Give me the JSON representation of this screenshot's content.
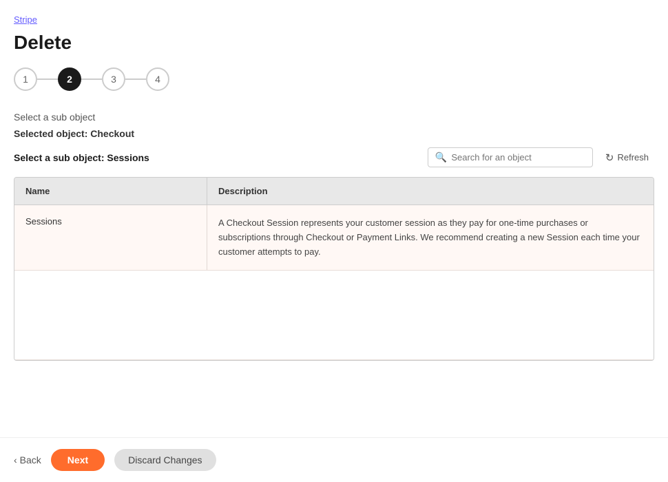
{
  "breadcrumb": {
    "label": "Stripe"
  },
  "page": {
    "title": "Delete"
  },
  "stepper": {
    "steps": [
      {
        "number": "1",
        "active": false
      },
      {
        "number": "2",
        "active": true
      },
      {
        "number": "3",
        "active": false
      },
      {
        "number": "4",
        "active": false
      }
    ]
  },
  "form": {
    "section_label": "Select a sub object",
    "selected_object_label": "Selected object: Checkout",
    "sub_object_label": "Select a sub object: Sessions",
    "search_placeholder": "Search for an object"
  },
  "toolbar": {
    "refresh_label": "Refresh"
  },
  "table": {
    "columns": [
      {
        "key": "name",
        "label": "Name"
      },
      {
        "key": "description",
        "label": "Description"
      }
    ],
    "rows": [
      {
        "name": "Sessions",
        "description": "A Checkout Session represents your customer session as they pay for one-time purchases or subscriptions through Checkout or Payment Links. We recommend creating a new Session each time your customer attempts to pay."
      }
    ]
  },
  "footer": {
    "back_label": "Back",
    "next_label": "Next",
    "discard_label": "Discard Changes"
  }
}
